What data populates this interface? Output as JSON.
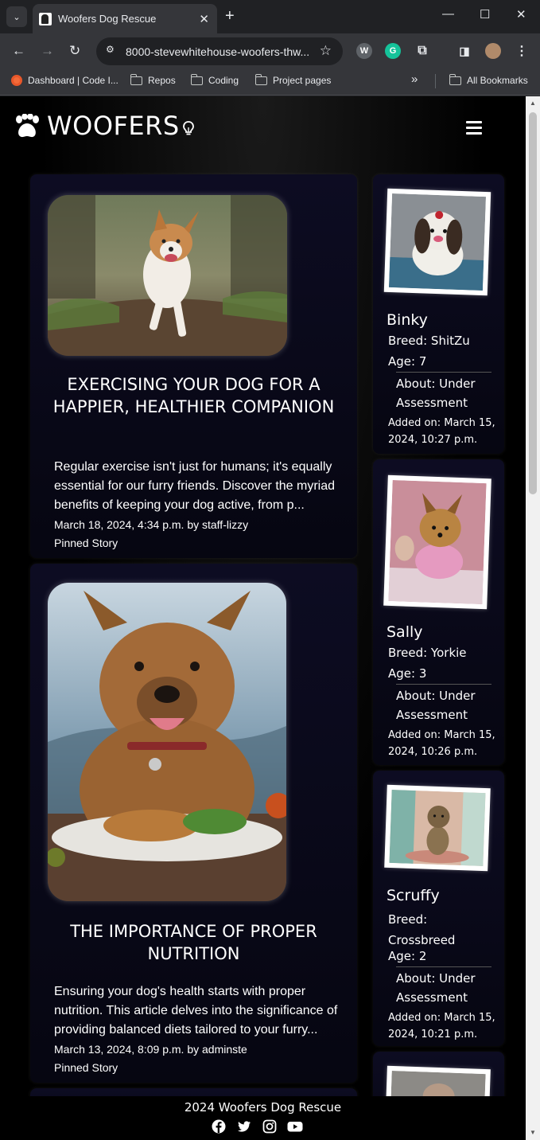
{
  "browser": {
    "tab_title": "Woofers Dog Rescue",
    "url": "8000-stevewhitehouse-woofers-thw...",
    "bookmarks": [
      {
        "label": "Dashboard | Code I...",
        "icon": "codeinstitute-icon"
      },
      {
        "label": "Repos",
        "icon": "folder-icon"
      },
      {
        "label": "Coding",
        "icon": "folder-icon"
      },
      {
        "label": "Project pages",
        "icon": "folder-icon"
      }
    ],
    "all_bookmarks": "All Bookmarks",
    "overflow": "»"
  },
  "nav": {
    "brand": "WOOFERS",
    "brand_icon": "paw-icon",
    "theme_icon": "lightbulb-icon",
    "menu_icon": "hamburger-menu-icon"
  },
  "posts": [
    {
      "title": "EXERCISING YOUR DOG FOR A HAPPIER, HEALTHIER COMPANION",
      "excerpt": "Regular exercise isn't just for humans; it's equally essential for our furry friends. Discover the myriad benefits of keeping your dog active, from p...",
      "meta": "March 18, 2024, 4:34 p.m. by staff-lizzy",
      "pinned": "Pinned Story",
      "image": "running-dog-photo"
    },
    {
      "title": "THE IMPORTANCE OF PROPER NUTRITION",
      "excerpt": "Ensuring your dog's health starts with proper nutrition. This article delves into the significance of providing balanced diets tailored to your furry...",
      "meta": "March 13, 2024, 8:09 p.m. by adminste",
      "pinned": "Pinned Story",
      "image": "dog-with-food-photo"
    }
  ],
  "dogs": [
    {
      "name": "Binky",
      "breed": "Breed: ShitZu",
      "age": "Age: 7",
      "about": "About: Under Assessment",
      "added": "Added on: March 15, 2024, 10:27 p.m."
    },
    {
      "name": "Sally",
      "breed": "Breed: Yorkie",
      "age": "Age: 3",
      "about": "About: Under Assessment",
      "added": "Added on: March 15, 2024, 10:26 p.m."
    },
    {
      "name": "Scruffy",
      "breed": "Breed: Crossbreed",
      "age": "Age: 2",
      "about": "About: Under Assessment",
      "added": "Added on: March 15, 2024, 10:21 p.m."
    }
  ],
  "footer": {
    "text": "2024 Woofers Dog Rescue",
    "social": [
      "facebook-icon",
      "twitter-icon",
      "instagram-icon",
      "youtube-icon"
    ]
  }
}
